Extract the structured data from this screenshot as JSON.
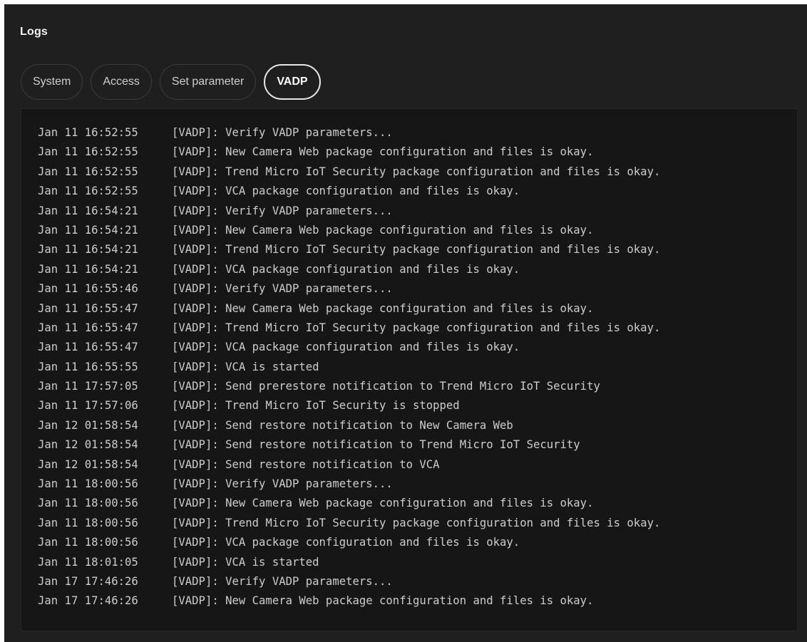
{
  "title": "Logs",
  "tabs": [
    {
      "label": "System",
      "active": false
    },
    {
      "label": "Access",
      "active": false
    },
    {
      "label": "Set parameter",
      "active": false
    },
    {
      "label": "VADP",
      "active": true
    }
  ],
  "logs": [
    {
      "time": "Jan 11 16:52:55",
      "message": "[VADP]: Verify VADP parameters..."
    },
    {
      "time": "Jan 11 16:52:55",
      "message": "[VADP]: New Camera Web package configuration and files is okay."
    },
    {
      "time": "Jan 11 16:52:55",
      "message": "[VADP]: Trend Micro IoT Security package configuration and files is okay."
    },
    {
      "time": "Jan 11 16:52:55",
      "message": "[VADP]: VCA package configuration and files is okay."
    },
    {
      "time": "Jan 11 16:54:21",
      "message": "[VADP]: Verify VADP parameters..."
    },
    {
      "time": "Jan 11 16:54:21",
      "message": "[VADP]: New Camera Web package configuration and files is okay."
    },
    {
      "time": "Jan 11 16:54:21",
      "message": "[VADP]: Trend Micro IoT Security package configuration and files is okay."
    },
    {
      "time": "Jan 11 16:54:21",
      "message": "[VADP]: VCA package configuration and files is okay."
    },
    {
      "time": "Jan 11 16:55:46",
      "message": "[VADP]: Verify VADP parameters..."
    },
    {
      "time": "Jan 11 16:55:47",
      "message": "[VADP]: New Camera Web package configuration and files is okay."
    },
    {
      "time": "Jan 11 16:55:47",
      "message": "[VADP]: Trend Micro IoT Security package configuration and files is okay."
    },
    {
      "time": "Jan 11 16:55:47",
      "message": "[VADP]: VCA package configuration and files is okay."
    },
    {
      "time": "Jan 11 16:55:55",
      "message": "[VADP]: VCA is started"
    },
    {
      "time": "Jan 11 17:57:05",
      "message": "[VADP]: Send prerestore notification to Trend Micro IoT Security"
    },
    {
      "time": "Jan 11 17:57:06",
      "message": "[VADP]: Trend Micro IoT Security is stopped"
    },
    {
      "time": "Jan 12 01:58:54",
      "message": "[VADP]: Send restore notification to New Camera Web"
    },
    {
      "time": "Jan 12 01:58:54",
      "message": "[VADP]: Send restore notification to Trend Micro IoT Security"
    },
    {
      "time": "Jan 12 01:58:54",
      "message": "[VADP]: Send restore notification to VCA"
    },
    {
      "time": "Jan 11 18:00:56",
      "message": "[VADP]: Verify VADP parameters..."
    },
    {
      "time": "Jan 11 18:00:56",
      "message": "[VADP]: New Camera Web package configuration and files is okay."
    },
    {
      "time": "Jan 11 18:00:56",
      "message": "[VADP]: Trend Micro IoT Security package configuration and files is okay."
    },
    {
      "time": "Jan 11 18:00:56",
      "message": "[VADP]: VCA package configuration and files is okay."
    },
    {
      "time": "Jan 11 18:01:05",
      "message": "[VADP]: VCA is started"
    },
    {
      "time": "Jan 17 17:46:26",
      "message": "[VADP]: Verify VADP parameters..."
    },
    {
      "time": "Jan 17 17:46:26",
      "message": "[VADP]: New Camera Web package configuration and files is okay."
    }
  ]
}
